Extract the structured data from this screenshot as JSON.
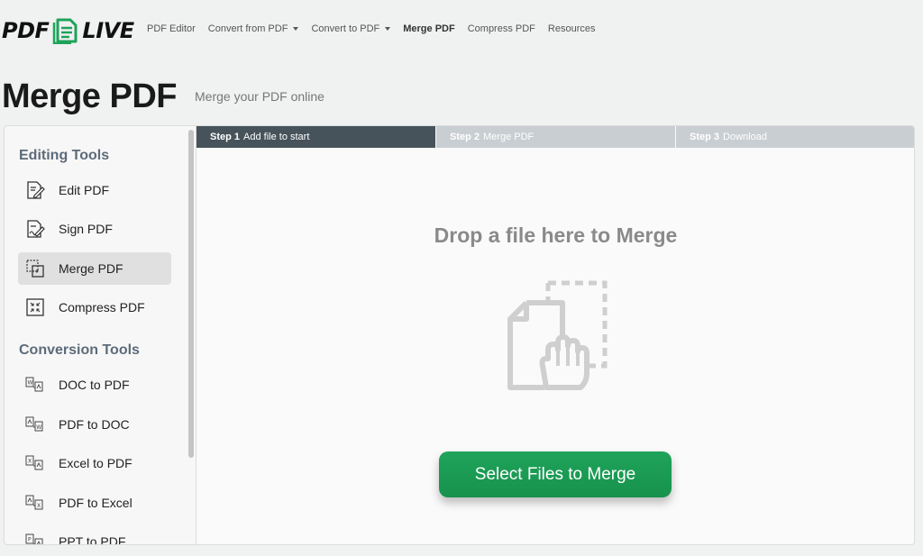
{
  "brand": {
    "logo_left": "PDF",
    "logo_right": "LIVE",
    "accent_green": "#1fa35a"
  },
  "nav": {
    "items": [
      {
        "label": "PDF Editor",
        "dropdown": false,
        "active": false
      },
      {
        "label": "Convert from PDF",
        "dropdown": true,
        "active": false
      },
      {
        "label": "Convert to PDF",
        "dropdown": true,
        "active": false
      },
      {
        "label": "Merge PDF",
        "dropdown": false,
        "active": true
      },
      {
        "label": "Compress PDF",
        "dropdown": false,
        "active": false
      },
      {
        "label": "Resources",
        "dropdown": false,
        "active": false
      }
    ]
  },
  "page": {
    "title": "Merge PDF",
    "subtitle": "Merge your PDF online"
  },
  "sidebar": {
    "editing_heading": "Editing Tools",
    "editing_tools": [
      {
        "label": "Edit PDF",
        "icon": "edit-pdf-icon",
        "active": false
      },
      {
        "label": "Sign PDF",
        "icon": "sign-pdf-icon",
        "active": false
      },
      {
        "label": "Merge PDF",
        "icon": "merge-pdf-icon",
        "active": true
      },
      {
        "label": "Compress PDF",
        "icon": "compress-pdf-icon",
        "active": false
      }
    ],
    "conversion_heading": "Conversion Tools",
    "conversion_tools": [
      {
        "label": "DOC to PDF",
        "icon": "doc-to-pdf-icon"
      },
      {
        "label": "PDF to DOC",
        "icon": "pdf-to-doc-icon"
      },
      {
        "label": "Excel to PDF",
        "icon": "excel-to-pdf-icon"
      },
      {
        "label": "PDF to Excel",
        "icon": "pdf-to-excel-icon"
      },
      {
        "label": "PPT to PDF",
        "icon": "ppt-to-pdf-icon"
      }
    ]
  },
  "steps": [
    {
      "number": "Step 1",
      "text": "Add file to start",
      "active": true
    },
    {
      "number": "Step 2",
      "text": "Merge PDF",
      "active": false
    },
    {
      "number": "Step 3",
      "text": "Download",
      "active": false
    }
  ],
  "dropzone": {
    "title": "Drop a file here to Merge",
    "icon": "drag-file-icon",
    "button_label": "Select Files to Merge"
  }
}
